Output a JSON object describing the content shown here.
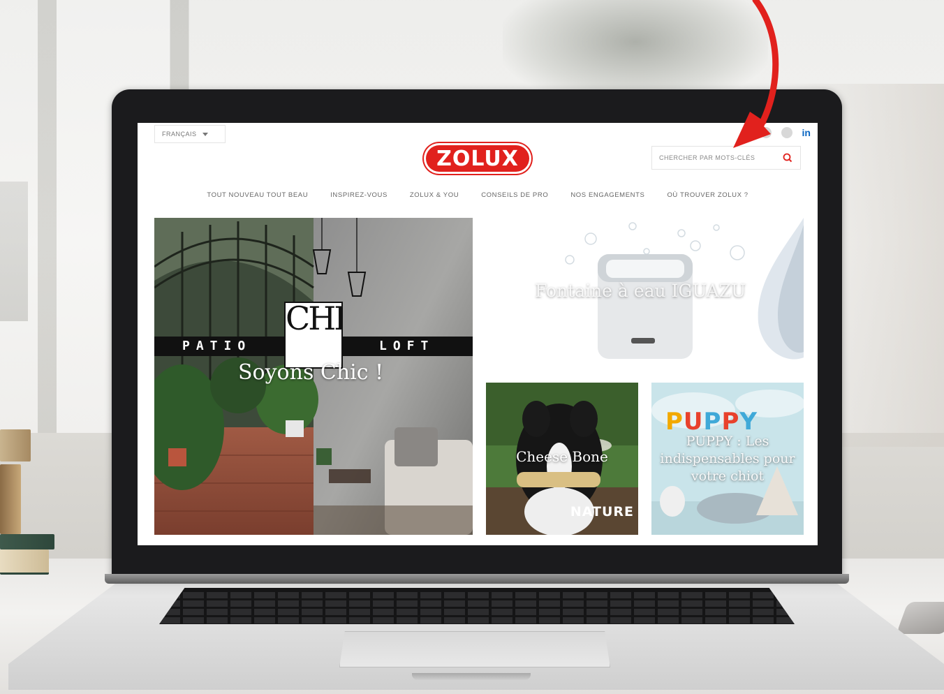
{
  "site": {
    "logo_text": "ZOLUX",
    "brand_color": "#e1211d"
  },
  "header": {
    "language_label": "FRANÇAIS",
    "search_placeholder": "CHERCHER PAR MOTS-CLÉS",
    "social_linkedin": "in"
  },
  "nav": {
    "items": [
      {
        "label": "TOUT NOUVEAU TOUT BEAU"
      },
      {
        "label": "INSPIREZ-VOUS"
      },
      {
        "label": "ZOLUX & YOU"
      },
      {
        "label": "CONSEILS DE PRO"
      },
      {
        "label": "NOS ENGAGEMENTS"
      },
      {
        "label": "OÙ TROUVER ZOLUX ?"
      }
    ]
  },
  "tiles": {
    "patio": {
      "title": "Soyons Chic !",
      "band_left": "PATIO",
      "band_right": "LOFT",
      "chic": "CHIC"
    },
    "fontaine": {
      "title": "Fontaine à eau IGUAZU"
    },
    "cheese": {
      "title": "Cheese Bone",
      "badge": "NATURE"
    },
    "puppy": {
      "title": "PUPPY : Les indispensables pour votre chiot",
      "logo": "PUPPY"
    }
  },
  "icons": {
    "search": "search-icon",
    "caret": "chevron-down-icon",
    "arrow": "red-arrow-annotation"
  },
  "annotation_color": "#e1211d"
}
